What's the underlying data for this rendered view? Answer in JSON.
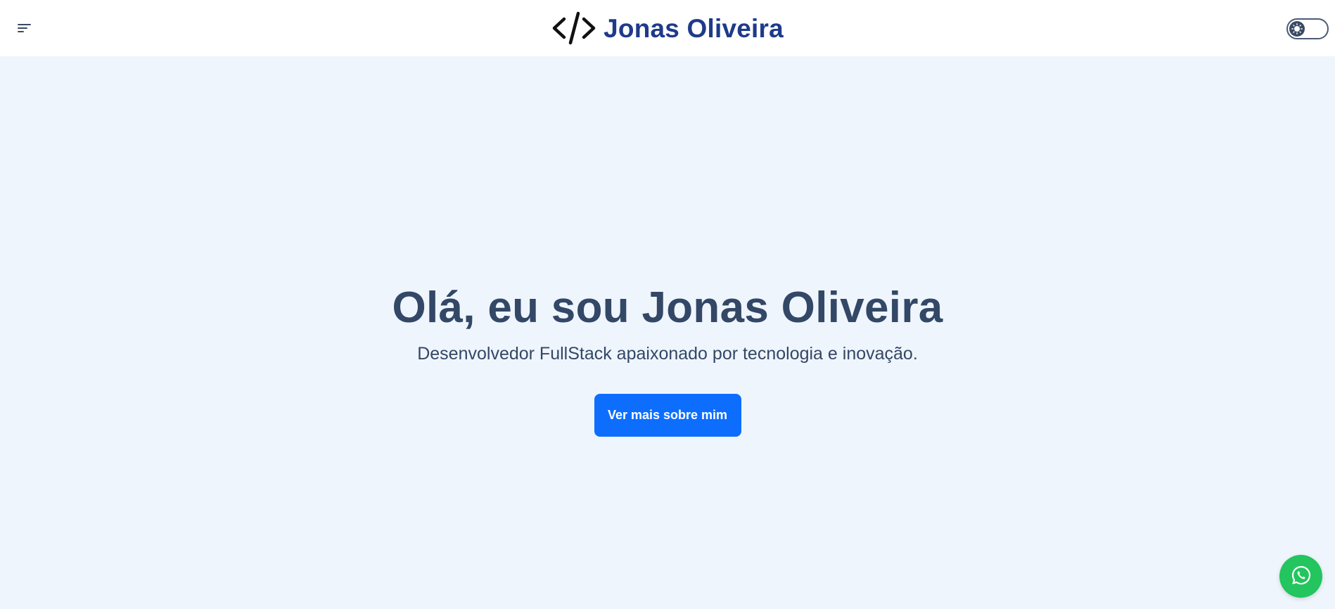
{
  "header": {
    "brand_name": "Jonas Oliveira",
    "menu_icon": "menu-icon",
    "logo_icon": "code-icon",
    "theme_toggle_icon": "sun-icon"
  },
  "hero": {
    "title": "Olá, eu sou Jonas Oliveira",
    "subtitle": "Desenvolvedor FullStack apaixonado por tecnologia e inovação.",
    "cta_label": "Ver mais sobre mim"
  },
  "fab": {
    "icon": "whatsapp-icon"
  },
  "colors": {
    "background": "#eff5fd",
    "header_bg": "#ffffff",
    "brand": "#1e3a8a",
    "heading": "#334766",
    "button": "#0d6efd",
    "whatsapp": "#22c55e"
  }
}
